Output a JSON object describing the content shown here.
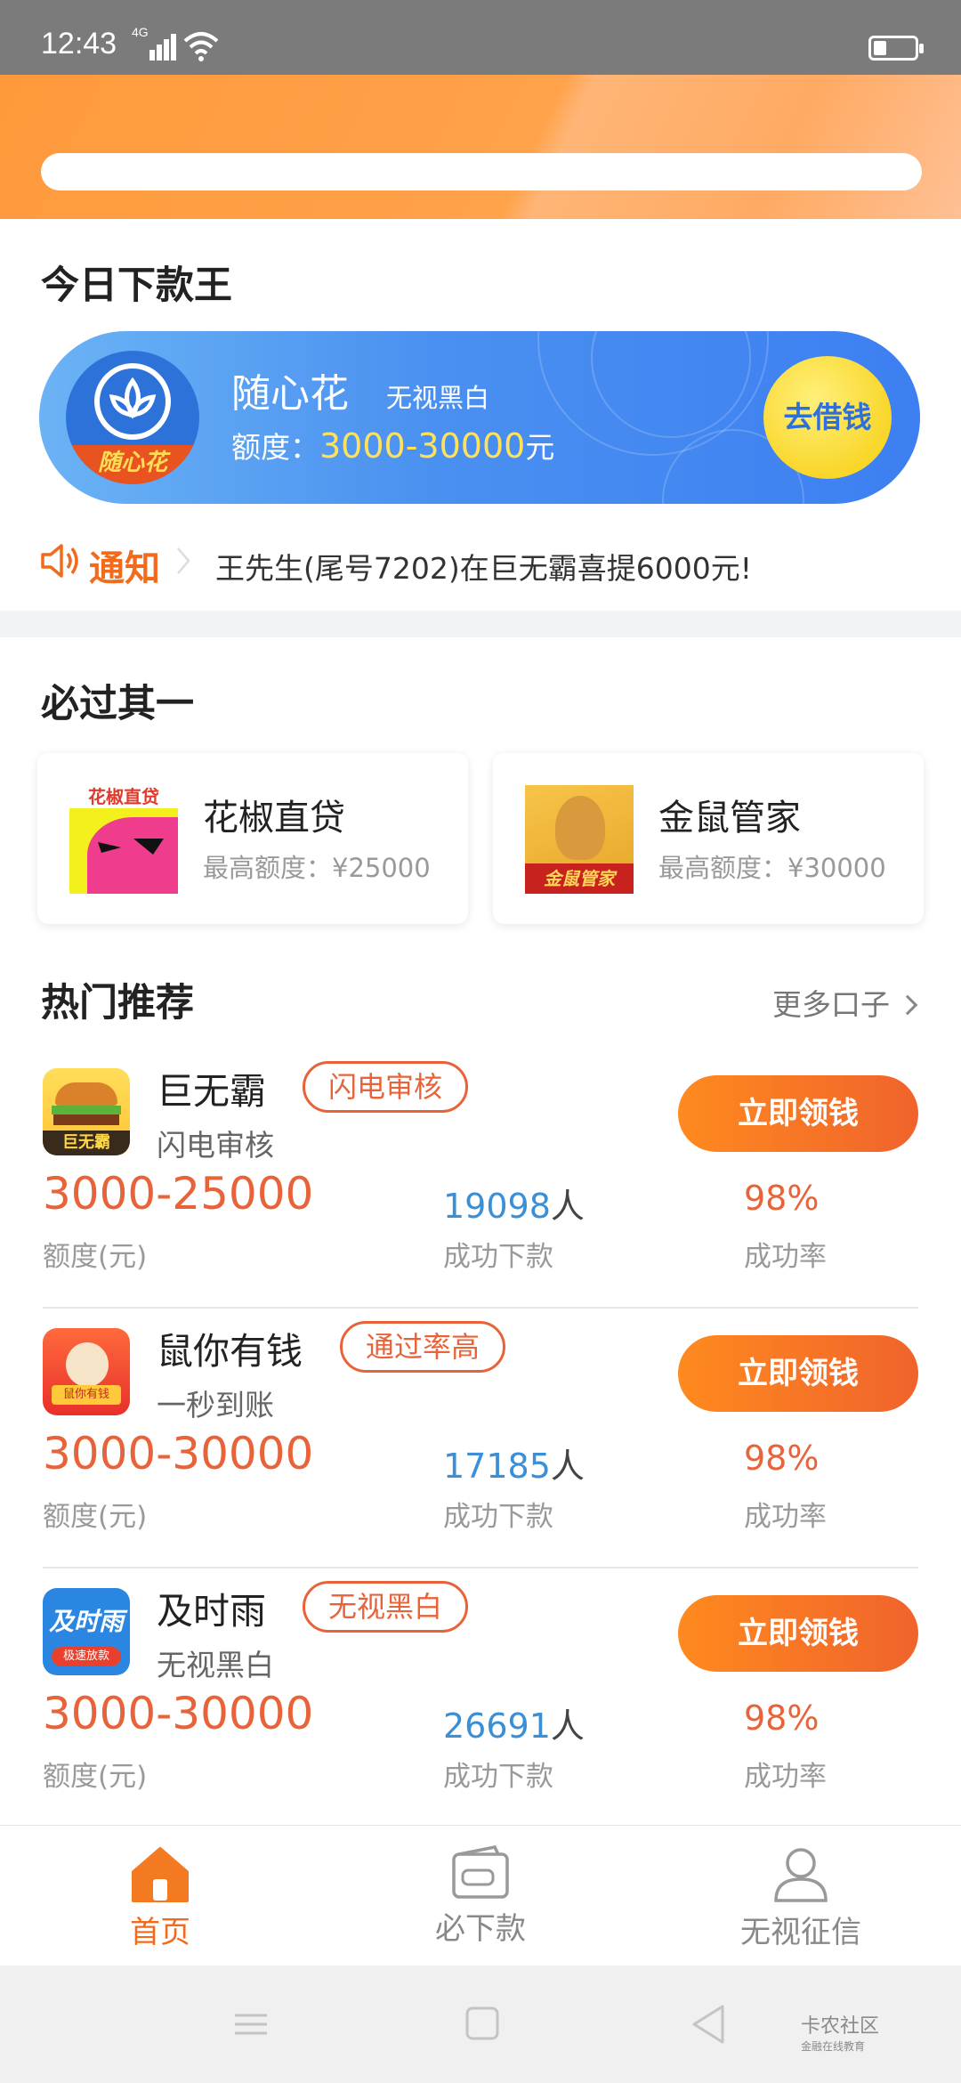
{
  "status_bar": {
    "time": "12:43",
    "network": "4G"
  },
  "king": {
    "title": "今日下款王",
    "product": {
      "name": "随心花",
      "tag": "无视黑白",
      "logo_text": "随心花",
      "limit_label": "额度：",
      "limit_value": "3000-30000",
      "limit_unit": "元",
      "button": "去借钱"
    },
    "notice": {
      "label": "通知",
      "text": "王先生(尾号7202)在巨无霸喜提6000元!"
    }
  },
  "must_pass": {
    "title": "必过其一",
    "cards": [
      {
        "name": "花椒直贷",
        "limit": "最高额度：¥25000",
        "icon_text": "花椒直贷"
      },
      {
        "name": "金鼠管家",
        "limit": "最高额度：¥30000",
        "icon_text": "金鼠管家"
      }
    ]
  },
  "hot": {
    "title": "热门推荐",
    "more": "更多口子",
    "items": [
      {
        "name": "巨无霸",
        "tag": "闪电审核",
        "sub": "闪电审核",
        "icon_text": "巨无霸",
        "button": "立即领钱",
        "amount": "3000-25000",
        "amount_label": "额度(元)",
        "count": "19098",
        "count_unit": "人",
        "count_label": "成功下款",
        "rate": "98%",
        "rate_label": "成功率"
      },
      {
        "name": "鼠你有钱",
        "tag": "通过率高",
        "sub": "一秒到账",
        "icon_text": "鼠你有钱",
        "button": "立即领钱",
        "amount": "3000-30000",
        "amount_label": "额度(元)",
        "count": "17185",
        "count_unit": "人",
        "count_label": "成功下款",
        "rate": "98%",
        "rate_label": "成功率"
      },
      {
        "name": "及时雨",
        "tag": "无视黑白",
        "sub": "无视黑白",
        "icon_text": "及时雨",
        "icon_sub": "极速放款",
        "button": "立即领钱",
        "amount": "3000-30000",
        "amount_label": "额度(元)",
        "count": "26691",
        "count_unit": "人",
        "count_label": "成功下款",
        "rate": "98%",
        "rate_label": "成功率"
      }
    ]
  },
  "tabs": [
    {
      "label": "首页",
      "icon": "home-icon",
      "active": true
    },
    {
      "label": "必下款",
      "icon": "wallet-icon",
      "active": false
    },
    {
      "label": "无视征信",
      "icon": "user-icon",
      "active": false
    }
  ],
  "watermark": {
    "main": "卡农社区",
    "sub": "金融在线教育"
  },
  "colors": {
    "accent": "#f26b1d",
    "banner": "#4a90f0",
    "count_blue": "#3a8fd6"
  }
}
